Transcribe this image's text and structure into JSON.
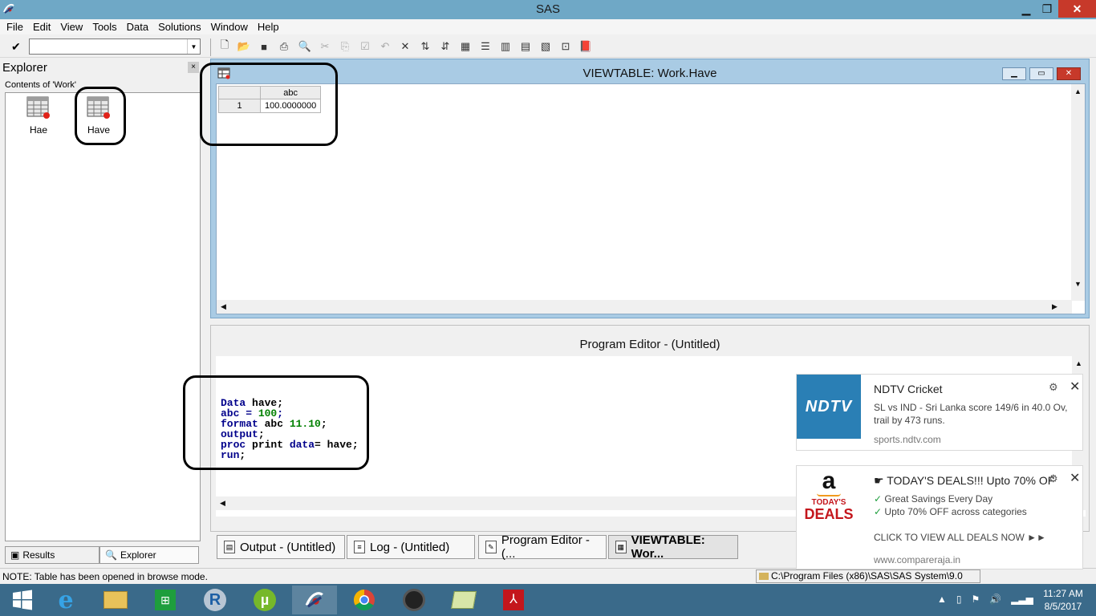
{
  "app": {
    "title": "SAS"
  },
  "menu": [
    "File",
    "Edit",
    "View",
    "Tools",
    "Data",
    "Solutions",
    "Window",
    "Help"
  ],
  "toolbar": {
    "command_value": ""
  },
  "explorer": {
    "title": "Explorer",
    "close_glyph": "×",
    "contents_label": "Contents of 'Work'",
    "items": [
      {
        "label": "Hae"
      },
      {
        "label": "Have"
      }
    ],
    "tabs": {
      "results": "Results",
      "explorer": "Explorer"
    }
  },
  "viewtable": {
    "title": "VIEWTABLE: Work.Have",
    "column_header": "abc",
    "rows": [
      {
        "row_num": "1",
        "value": "100.0000000"
      }
    ]
  },
  "program_editor": {
    "title": "Program Editor - (Untitled)",
    "code": {
      "l1_kw": "Data",
      "l1_rest": " have;",
      "l2_kw": "abc = ",
      "l2_num": "100",
      "l2_rest": ";",
      "l3_kw": "format",
      "l3_mid": " abc ",
      "l3_num": "11.10",
      "l3_rest": ";",
      "l4_kw": "output",
      "l4_rest": ";",
      "l5_kw1": "proc",
      "l5_mid": " print ",
      "l5_kw2": "data",
      "l5_rest": "= have;",
      "l6_kw": "run",
      "l6_rest": ";"
    }
  },
  "window_tabs": [
    {
      "label": "Output - (Untitled)"
    },
    {
      "label": "Log - (Untitled)"
    },
    {
      "label": "Program Editor - (..."
    },
    {
      "label": "VIEWTABLE: Wor..."
    }
  ],
  "status": {
    "note": "NOTE: Table has been opened in browse mode.",
    "path": "C:\\Program Files (x86)\\SAS\\SAS System\\9.0"
  },
  "notifications": {
    "ndtv": {
      "logo_text": "NDTV",
      "title": "NDTV Cricket",
      "line1": "SL vs IND - Sri Lanka score 149/6 in 40.0 Ov,",
      "line2": "trail by 473 runs.",
      "source": "sports.ndtv.com"
    },
    "amazon": {
      "logo_letter": "a",
      "logo_text_1": "TODAY'S",
      "logo_text_2": "DEALS",
      "title": "☛ TODAY'S DEALS!!! Upto 70% OF",
      "check1": "Great Savings Every Day",
      "check2": "Upto 70% OFF across categories",
      "cta": "CLICK TO VIEW ALL DEALS NOW ►►",
      "source": "www.compareraja.in"
    }
  },
  "clock": {
    "time": "11:27 AM",
    "date": "8/5/2017"
  },
  "colors": {
    "titlebar": "#6fa8c6",
    "mdi_frame": "#a9cbe4",
    "keyword": "#00008b",
    "number": "#008000",
    "taskbar": "#3a6a8a"
  }
}
